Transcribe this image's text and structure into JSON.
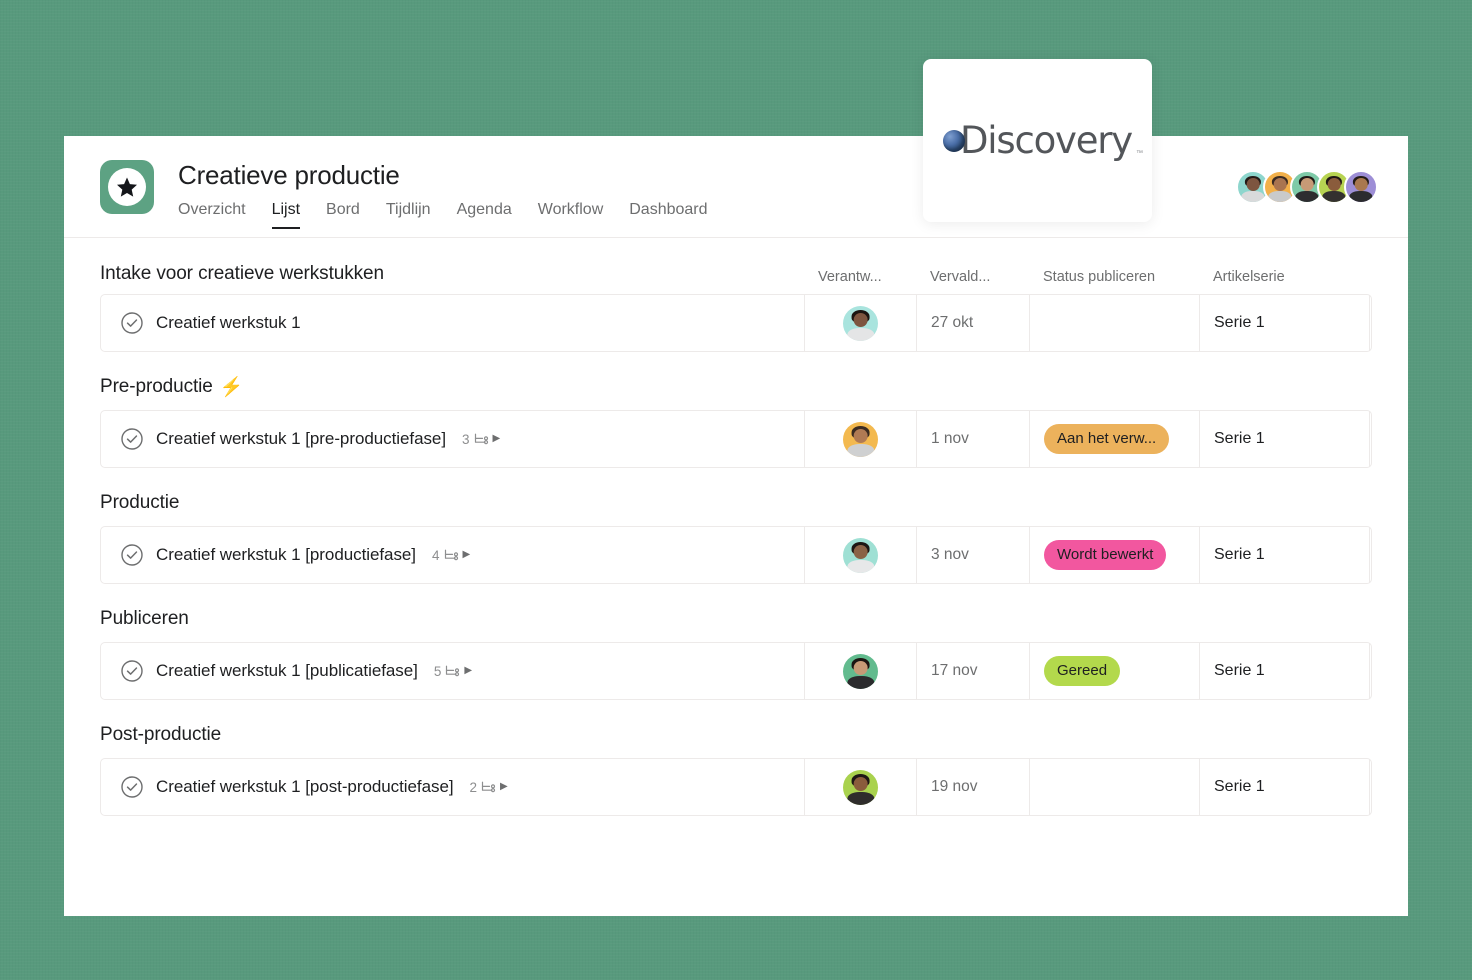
{
  "background": {
    "color": "#589a7d"
  },
  "logo_card": {
    "brand": "Discovery",
    "trademark": "™",
    "icon": "globe-icon"
  },
  "header": {
    "project_icon": "star-icon",
    "title": "Creatieve productie",
    "tabs": [
      {
        "label": "Overzicht",
        "active": false
      },
      {
        "label": "Lijst",
        "active": true
      },
      {
        "label": "Bord",
        "active": false
      },
      {
        "label": "Tijdlijn",
        "active": false
      },
      {
        "label": "Agenda",
        "active": false
      },
      {
        "label": "Workflow",
        "active": false
      },
      {
        "label": "Dashboard",
        "active": false
      }
    ],
    "members": [
      {
        "name": "member-1",
        "bg": "#8ed6cd",
        "skin": "#7d5540",
        "hair": "#241a16",
        "body": "#d9dadb"
      },
      {
        "name": "member-2",
        "bg": "#f2b04a",
        "skin": "#a97450",
        "hair": "#3a2a22",
        "body": "#c9cacb"
      },
      {
        "name": "member-3",
        "bg": "#7ecaa8",
        "skin": "#c79a76",
        "hair": "#1f1a17",
        "body": "#2d2d30"
      },
      {
        "name": "member-4",
        "bg": "#b7d352",
        "skin": "#8a5c3c",
        "hair": "#201714",
        "body": "#33312f"
      },
      {
        "name": "member-5",
        "bg": "#9d8ed6",
        "skin": "#a9784f",
        "hair": "#231b17",
        "body": "#2b2b2e"
      }
    ]
  },
  "columns": {
    "task": "Intake voor creatieve werkstukken",
    "assignee": "Verantw...",
    "due": "Vervald...",
    "status": "Status publiceren",
    "series": "Artikelserie"
  },
  "sections": [
    {
      "title": "Intake voor creatieve werkstukken",
      "bolt": "",
      "is_column_header_row": true,
      "tasks": [
        {
          "check": "check-circle-icon",
          "name": "Creatief werkstuk 1",
          "subtask_count": "",
          "subtask_icon": "",
          "caret": "",
          "assignee": {
            "name": "assignee-1",
            "bg": "#a9e4de",
            "skin": "#7d5540",
            "hair": "#1c1512",
            "body": "#e4e5e6"
          },
          "due": "27 okt",
          "status": "",
          "status_color": "",
          "series": "Serie 1"
        }
      ]
    },
    {
      "title": "Pre-productie",
      "bolt": "⚡",
      "is_column_header_row": false,
      "tasks": [
        {
          "check": "check-circle-icon",
          "name": "Creatief werkstuk 1 [pre-productiefase]",
          "subtask_count": "3",
          "subtask_icon": "subtask-icon",
          "caret": "▶",
          "assignee": {
            "name": "assignee-2",
            "bg": "#f3b94f",
            "skin": "#b07a54",
            "hair": "#3b2b21",
            "body": "#cfd0d1"
          },
          "due": "1 nov",
          "status": "Aan het verw...",
          "status_color": "#ecb25c",
          "series": "Serie 1"
        }
      ]
    },
    {
      "title": "Productie",
      "bolt": "",
      "is_column_header_row": false,
      "tasks": [
        {
          "check": "check-circle-icon",
          "name": "Creatief werkstuk 1 [productiefase]",
          "subtask_count": "4",
          "subtask_icon": "subtask-icon",
          "caret": "▶",
          "assignee": {
            "name": "assignee-3",
            "bg": "#9fe0d4",
            "skin": "#8a6246",
            "hair": "#1d1613",
            "body": "#e7e8e9"
          },
          "due": "3 nov",
          "status": "Wordt bewerkt",
          "status_color": "#f2579f",
          "series": "Serie 1"
        }
      ]
    },
    {
      "title": "Publiceren",
      "bolt": "",
      "is_column_header_row": false,
      "tasks": [
        {
          "check": "check-circle-icon",
          "name": "Creatief werkstuk 1 [publicatiefase]",
          "subtask_count": "5",
          "subtask_icon": "subtask-icon",
          "caret": "▶",
          "assignee": {
            "name": "assignee-4",
            "bg": "#62bb8e",
            "skin": "#c79a76",
            "hair": "#1c1512",
            "body": "#2b2b2d"
          },
          "due": "17 nov",
          "status": "Gereed",
          "status_color": "#b3d94c",
          "series": "Serie 1"
        }
      ]
    },
    {
      "title": "Post-productie",
      "bolt": "",
      "is_column_header_row": false,
      "tasks": [
        {
          "check": "check-circle-icon",
          "name": "Creatief werkstuk 1 [post-productiefase]",
          "subtask_count": "2",
          "subtask_icon": "subtask-icon",
          "caret": "▶",
          "assignee": {
            "name": "assignee-5",
            "bg": "#a9d24e",
            "skin": "#8a5c3c",
            "hair": "#1e1714",
            "body": "#2f2d2c"
          },
          "due": "19 nov",
          "status": "",
          "status_color": "",
          "series": "Serie 1"
        }
      ]
    }
  ]
}
